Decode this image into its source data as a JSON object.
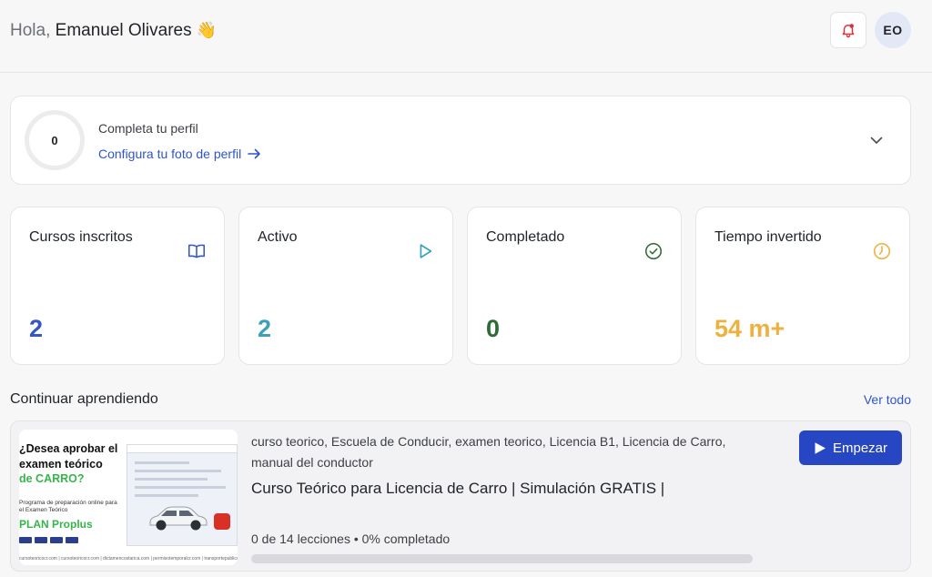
{
  "header": {
    "greeting": "Hola,",
    "user_name": "Emanuel Olivares",
    "wave_emoji": "👋",
    "avatar_initials": "EO",
    "bell_icon": "bell-alert-icon"
  },
  "profile": {
    "progress_value": "0",
    "title": "Completa tu perfil",
    "link_label": "Configura tu foto de perfil"
  },
  "stats": [
    {
      "label": "Cursos inscritos",
      "value": "2",
      "icon": "book-open-icon",
      "color": "#3556c4"
    },
    {
      "label": "Activo",
      "value": "2",
      "icon": "play-icon",
      "color": "#3aa1b9"
    },
    {
      "label": "Completado",
      "value": "0",
      "icon": "check-circle-icon",
      "color": "#2f6b36"
    },
    {
      "label": "Tiempo invertido",
      "value": "54 m+",
      "icon": "clock-icon",
      "color": "#eeb13f"
    }
  ],
  "continue_section": {
    "title": "Continuar aprendiendo",
    "see_all": "Ver todo"
  },
  "course": {
    "tags": "curso teorico, Escuela de Conducir, examen teorico, Licencia B1, Licencia de Carro, manual del conductor",
    "name": "Curso Teórico para Licencia de Carro | Simulación GRATIS |",
    "progress_text": "0 de 14 lecciones • 0% completado",
    "progress_fraction": 0,
    "start_label": "Empezar",
    "thumbnail": {
      "line1": "¿Desea aprobar el",
      "line2": "examen teórico",
      "line3": "de CARRO?",
      "line4": "Programa de preparación online para el Examen Teórico",
      "line5": "PLAN Proplus",
      "footer": "cursoteoricocr.com | cursoteoricocr.com | dictamencostarica.com | permisotemporalcr.com | transportepublicocr"
    }
  }
}
